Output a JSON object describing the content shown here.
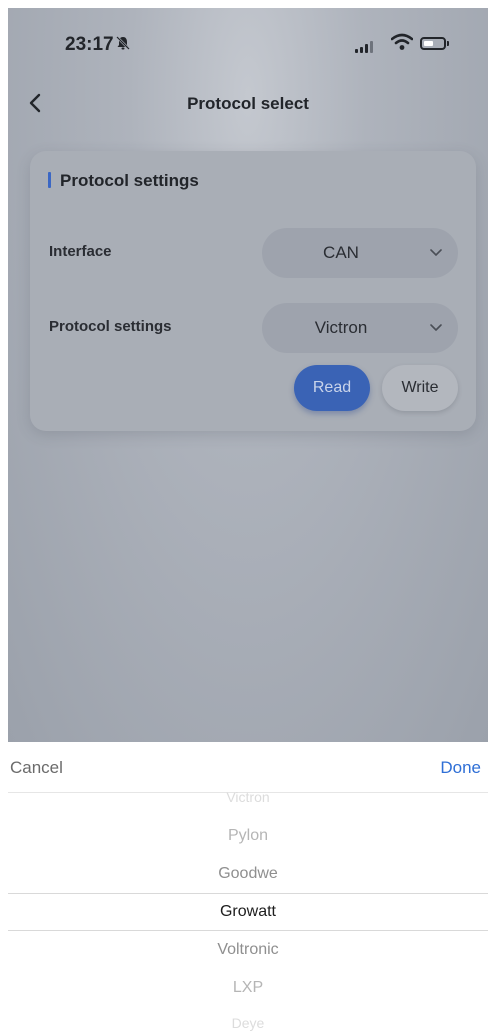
{
  "status_bar": {
    "time": "23:17"
  },
  "nav": {
    "title": "Protocol select"
  },
  "card": {
    "section_title": "Protocol settings",
    "interface": {
      "label": "Interface",
      "value": "CAN"
    },
    "protocol": {
      "label": "Protocol settings",
      "value": "Victron"
    },
    "read_label": "Read",
    "write_label": "Write"
  },
  "picker": {
    "cancel_label": "Cancel",
    "done_label": "Done",
    "options": [
      "Victron",
      "Pylon",
      "Goodwe",
      "Growatt",
      "Voltronic",
      "LXP",
      "Deye"
    ],
    "selected": "Growatt"
  },
  "colors": {
    "accent": "#2f6fd6",
    "read_button": "#3a63b5",
    "section_bar": "#3b67c4"
  }
}
